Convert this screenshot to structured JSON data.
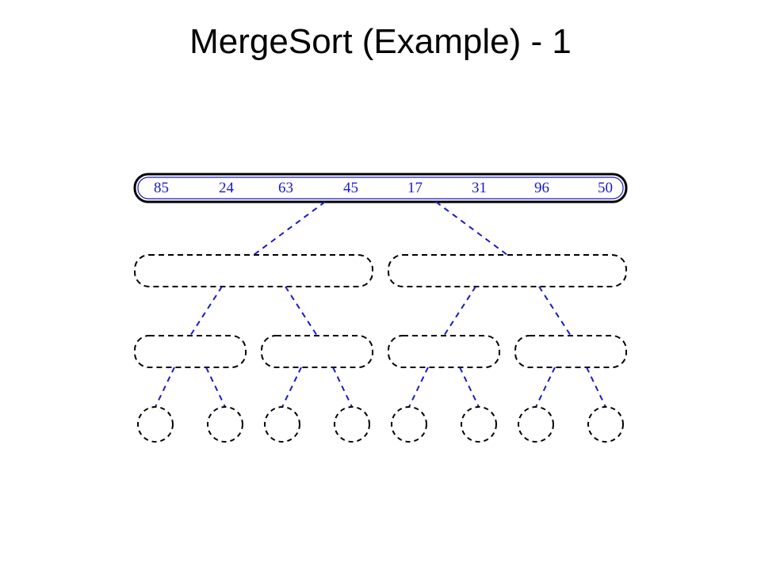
{
  "title": "MergeSort (Example) - 1",
  "values": {
    "v0": "85",
    "v1": "24",
    "v2": "63",
    "v3": "45",
    "v4": "17",
    "v5": "31",
    "v6": "96",
    "v7": "50"
  },
  "colors": {
    "dash": "#000000",
    "dashBlue": "#1a1ac8",
    "solid": "#000000"
  }
}
